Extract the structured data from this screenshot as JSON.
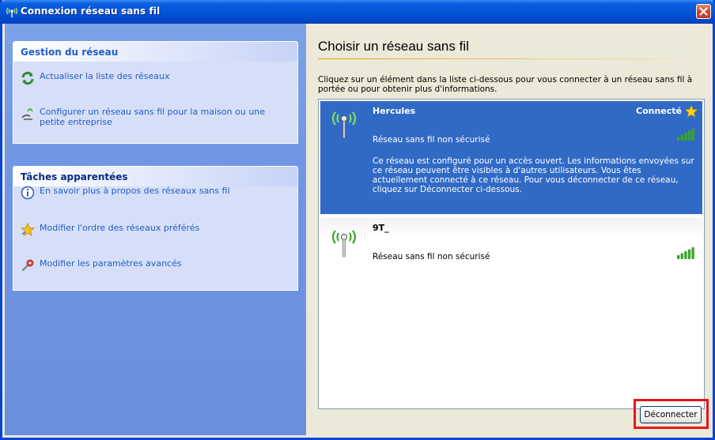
{
  "window": {
    "title": "Connexion réseau sans fil",
    "close_label": "close"
  },
  "sidebar": {
    "network_panel": {
      "title": "Gestion du réseau",
      "tasks": [
        {
          "label": "Actualiser la liste des réseaux",
          "icon": "refresh-icon"
        },
        {
          "label": "Configurer un réseau sans fil pour la maison ou une petite entreprise",
          "icon": "wizard-icon"
        }
      ]
    },
    "related_panel": {
      "title": "Tâches apparentées",
      "tasks": [
        {
          "label": "En savoir plus à propos des réseaux sans fil",
          "icon": "info-icon"
        },
        {
          "label": "Modifier l'ordre des réseaux préférés",
          "icon": "star-icon"
        },
        {
          "label": "Modifier les paramètres avancés",
          "icon": "settings-icon"
        }
      ]
    }
  },
  "main": {
    "heading": "Choisir un réseau sans fil",
    "instructions": "Cliquez sur un élément dans la liste ci-dessous pour vous connecter à un réseau sans fil à portée ou pour obtenir plus d'informations.",
    "networks": [
      {
        "name": "Hercules",
        "status": "Connecté",
        "security": "Réseau sans fil non sécurisé",
        "signal_bars": 5,
        "selected": true,
        "description": "Ce réseau est configuré pour un accès ouvert. Les informations envoyées sur ce réseau peuvent être visibles à d'autres utilisateurs. Vous êtes actuellement connecté à ce réseau. Pour vous déconnecter de ce réseau, cliquez sur Déconnecter ci-dessous."
      },
      {
        "name": "9T_",
        "security": "Réseau sans fil non sécurisé",
        "signal_bars": 5,
        "selected": false
      }
    ],
    "disconnect_label": "Déconnecter"
  },
  "colors": {
    "title_bar": "#0453d8",
    "task_pane": "#6f95e3",
    "selection": "#316ac5",
    "link": "#215dc6",
    "signal_green": "#3aa52a",
    "highlight_box": "#e8141c"
  }
}
